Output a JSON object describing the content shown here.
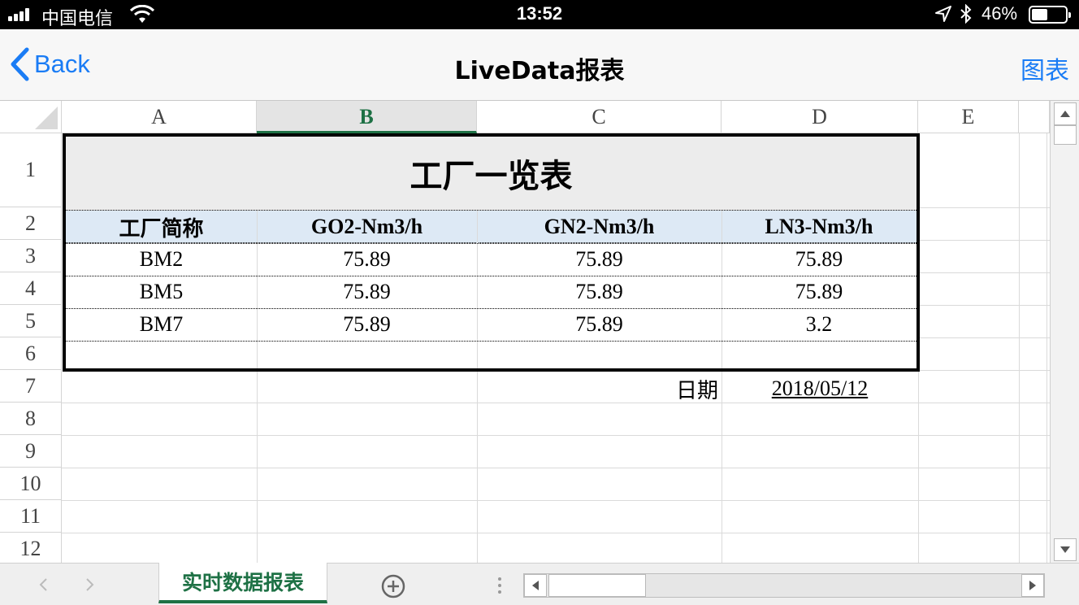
{
  "status_bar": {
    "carrier": "中国电信",
    "time": "13:52",
    "battery_percent": "46%",
    "icons": [
      "signal-icon",
      "wifi-icon",
      "location-icon",
      "bluetooth-icon",
      "battery-icon"
    ]
  },
  "nav": {
    "back_label": "Back",
    "title": "LiveData报表",
    "chart_label": "图表",
    "accent_color": "#1a7cf5"
  },
  "sheet": {
    "columns": [
      "A",
      "B",
      "C",
      "D",
      "E"
    ],
    "selected_column": "B",
    "rows": [
      "1",
      "2",
      "3",
      "4",
      "5",
      "6",
      "7",
      "8",
      "9",
      "10",
      "11",
      "12"
    ],
    "report_title": "工厂一览表",
    "headers": [
      "工厂简称",
      "GO2-Nm3/h",
      "GN2-Nm3/h",
      "LN3-Nm3/h"
    ],
    "data": [
      [
        "BM2",
        "75.89",
        "75.89",
        "75.89"
      ],
      [
        "BM5",
        "75.89",
        "75.89",
        "75.89"
      ],
      [
        "BM7",
        "75.89",
        "75.89",
        "3.2"
      ]
    ],
    "date_label": "日期",
    "date_value": "2018/05/12",
    "header_fill": "#dde9f5",
    "title_fill": "#ececec"
  },
  "tabs": {
    "active_tab": "实时数据报表",
    "accent_color": "#1e7145"
  }
}
